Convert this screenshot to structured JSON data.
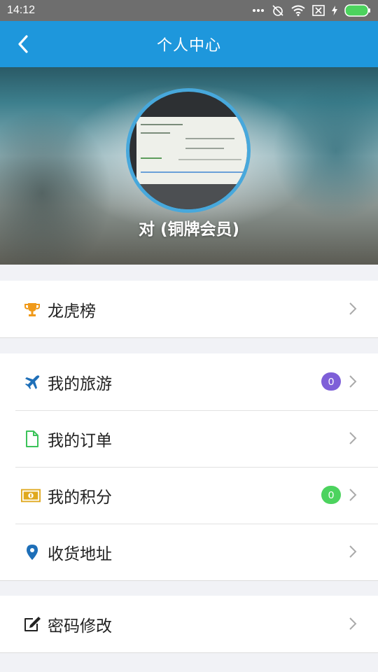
{
  "status_bar": {
    "time": "14:12"
  },
  "header": {
    "title": "个人中心"
  },
  "profile": {
    "username": "对 (铜牌会员)"
  },
  "menu_groups": [
    {
      "items": [
        {
          "label": "龙虎榜",
          "icon": "trophy-icon",
          "icon_color": "#f09a1a"
        }
      ]
    },
    {
      "items": [
        {
          "label": "我的旅游",
          "icon": "airplane-icon",
          "icon_color": "#1e6fb8",
          "badge": "0",
          "badge_color": "#7e5fd8"
        },
        {
          "label": "我的订单",
          "icon": "document-icon",
          "icon_color": "#3cc35a"
        },
        {
          "label": "我的积分",
          "icon": "money-icon",
          "icon_color": "#e0a91f",
          "badge": "0",
          "badge_color": "#4cd35e"
        },
        {
          "label": "收货地址",
          "icon": "location-pin-icon",
          "icon_color": "#1e6fb8"
        }
      ]
    },
    {
      "items": [
        {
          "label": "密码修改",
          "icon": "edit-icon",
          "icon_color": "#222222"
        }
      ]
    }
  ],
  "colors": {
    "title_bar": "#1e97dc",
    "status_bar": "#6e6e6e",
    "avatar_border": "#47a8dc"
  }
}
